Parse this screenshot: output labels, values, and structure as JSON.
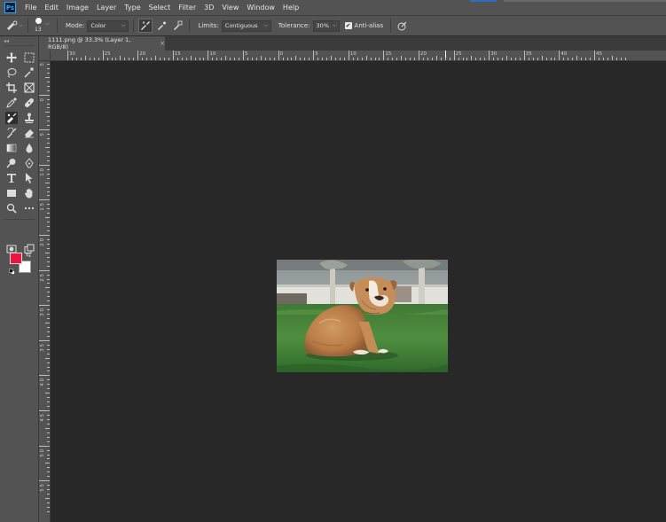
{
  "app": {
    "logo_text": "Ps",
    "menu": [
      "File",
      "Edit",
      "Image",
      "Layer",
      "Type",
      "Select",
      "Filter",
      "3D",
      "View",
      "Window",
      "Help"
    ]
  },
  "options_bar": {
    "tool_icon": "color-replacement-brush-icon",
    "brush_size": "13",
    "mode_label": "Mode:",
    "mode_value": "Color",
    "sampling_icons": [
      "sampling-continuous-icon",
      "sampling-once-icon",
      "sampling-background-swatch-icon"
    ],
    "limits_label": "Limits:",
    "limits_value": "Contiguous",
    "tolerance_label": "Tolerance:",
    "tolerance_value": "30%",
    "antialias_label": "Anti-alias",
    "antialias_checked": true,
    "pressure_icon": "pen-pressure-icon"
  },
  "document_tab": {
    "title": "1111.png @ 33.3% (Layer 1, RGB/8)",
    "close": "×"
  },
  "rulers": {
    "top_labels": [
      "30",
      "25",
      "20",
      "15",
      "10",
      "5",
      "0",
      "5",
      "10",
      "15",
      "20",
      "25",
      "30",
      "35",
      "40",
      "45"
    ],
    "left_labels": [
      "5",
      "0",
      "5",
      "1 0",
      "1 5",
      "2 0",
      "2 5",
      "3 0",
      "3 5",
      "4 0",
      "4 5",
      "5 0",
      "5 5"
    ]
  },
  "toolbar": {
    "tools": [
      "move-icon",
      "marquee-icon",
      "lasso-icon",
      "magic-wand-icon",
      "crop-icon",
      "frame-icon",
      "eyedropper-icon",
      "healing-brush-icon",
      "color-replacement-brush-icon",
      "clone-stamp-icon",
      "history-brush-icon",
      "eraser-icon",
      "gradient-icon",
      "blur-icon",
      "dodge-icon",
      "pen-icon",
      "type-icon",
      "path-selection-icon",
      "rectangle-icon",
      "hand-icon",
      "zoom-icon",
      "more-tools-icon"
    ],
    "selected_tool": "color-replacement-brush-icon",
    "foreground_color": "#e8163f",
    "background_color": "#ffffff"
  },
  "colors": {
    "ui_dark": "#282828",
    "ui_panel": "#535353",
    "accent_blue": "#31a8ff"
  }
}
